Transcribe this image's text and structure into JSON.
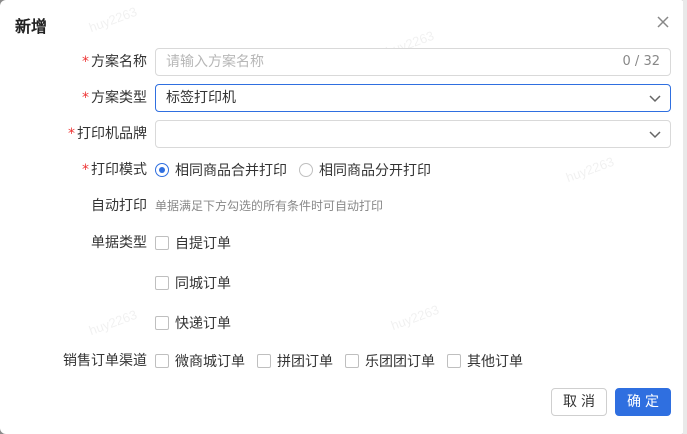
{
  "dialog": {
    "title": "新增",
    "close_icon": "close-icon"
  },
  "watermark": "huy2263",
  "form": {
    "scheme_name": {
      "label": "方案名称",
      "required": "*",
      "placeholder": "请输入方案名称",
      "counter": "0 / 32"
    },
    "scheme_type": {
      "label": "方案类型",
      "required": "*",
      "value": "标签打印机"
    },
    "printer_brand": {
      "label": "打印机品牌",
      "required": "*",
      "value": ""
    },
    "print_mode": {
      "label": "打印模式",
      "required": "*",
      "options": [
        "相同商品合并打印",
        "相同商品分开打印"
      ],
      "selected": "相同商品合并打印"
    },
    "auto_print": {
      "label": "自动打印",
      "hint": "单据满足下方勾选的所有条件时可自动打印"
    },
    "doc_type": {
      "label": "单据类型",
      "options": [
        "自提订单",
        "同城订单",
        "快递订单"
      ]
    },
    "sales_channel": {
      "label": "销售订单渠道",
      "options": [
        "微商城订单",
        "拼团订单",
        "乐团团订单",
        "其他订单"
      ]
    }
  },
  "footer": {
    "cancel_label": "取消",
    "ok_label": "确定"
  },
  "colors": {
    "accent": "#2f6fe0",
    "required": "#e33333"
  }
}
